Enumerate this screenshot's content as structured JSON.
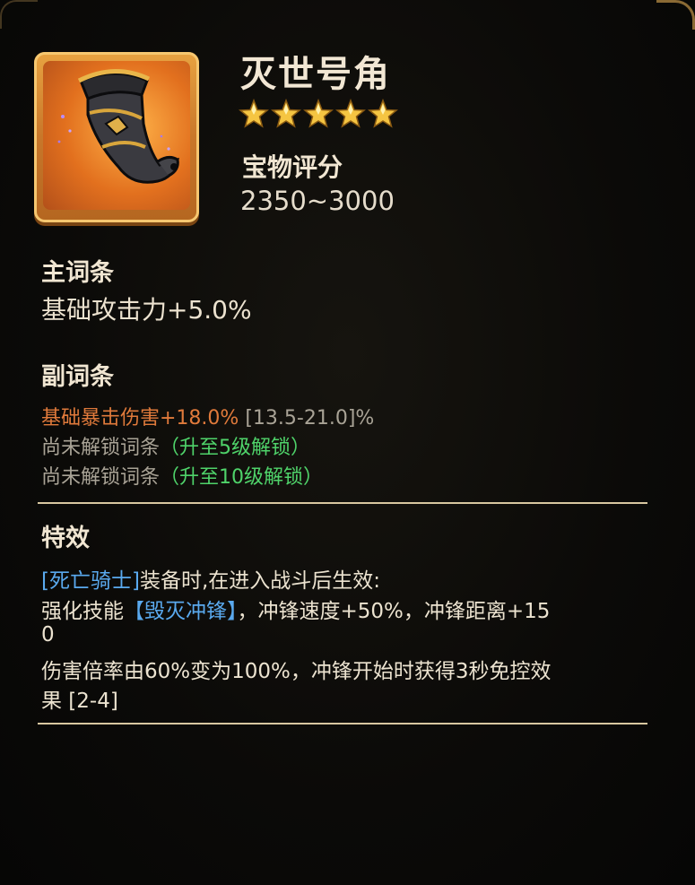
{
  "item": {
    "name": "灭世号角",
    "stars": 5,
    "icon": "horn-icon"
  },
  "score": {
    "label": "宝物评分",
    "value": "2350~3000"
  },
  "main_affix": {
    "title": "主词条",
    "stat": "基础攻击力+5.0%"
  },
  "sub_affix": {
    "title": "副词条",
    "line1_stat": "基础暴击伤害+18.0%",
    "line1_range": "[13.5-21.0]%",
    "line2_text": "尚未解锁词条",
    "line2_note": "（升至5级解锁）",
    "line3_text": "尚未解锁词条",
    "line3_note": "（升至10级解锁）"
  },
  "effect": {
    "title": "特效",
    "hero_tag": "[死亡骑士]",
    "line1_rest": "装备时,在进入战斗后生效:",
    "line2_prefix": "强化技能",
    "line2_skill": "【毁灭冲锋】",
    "line2_rest": "，冲锋速度+50%，冲锋距离+15",
    "line3": "0",
    "line4": "伤害倍率由60%变为100%，冲锋开始时获得3秒免控效",
    "line5": "果 [2-4]"
  },
  "colors": {
    "background": "#0b0a08",
    "title": "#f2e7d4",
    "star": "#f5c542",
    "sub_stat": "#e07a3b",
    "locked": "#a9a396",
    "unlock_note": "#4fd36a",
    "highlight_blue": "#5aa9ee",
    "divider": "#d8c7a0",
    "frame_orange": "#e2701e"
  }
}
